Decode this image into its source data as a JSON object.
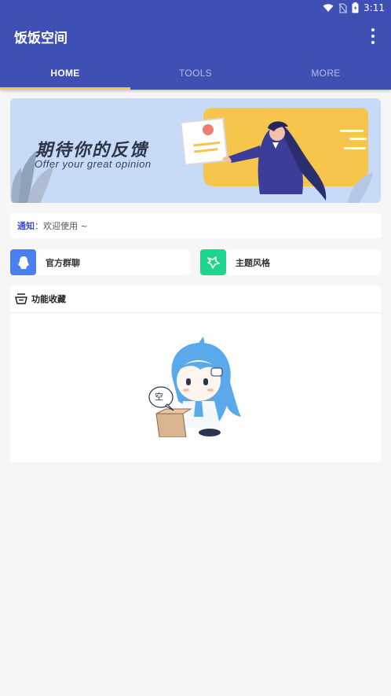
{
  "status_bar": {
    "time": "3:11"
  },
  "app_bar": {
    "title": "饭饭空间"
  },
  "tabs": [
    {
      "label": "HOME",
      "active": true
    },
    {
      "label": "TOOLS",
      "active": false
    },
    {
      "label": "MORE",
      "active": false
    }
  ],
  "banner": {
    "title": "期待你的反馈",
    "subtitle": "Offer your great opinion"
  },
  "notice": {
    "label": "通知",
    "separator": "：",
    "text": "欢迎使用 ~"
  },
  "quick_actions": [
    {
      "label": "官方群聊",
      "icon": "qq-icon",
      "color": "#4a7ff2"
    },
    {
      "label": "主题风格",
      "icon": "palette-icon",
      "color": "#1dd68c"
    }
  ],
  "favorites": {
    "title": "功能收藏",
    "empty_bubble": "空"
  },
  "colors": {
    "primary": "#3e50b4",
    "accent": "#f5c942",
    "background": "#f6f6f6"
  }
}
